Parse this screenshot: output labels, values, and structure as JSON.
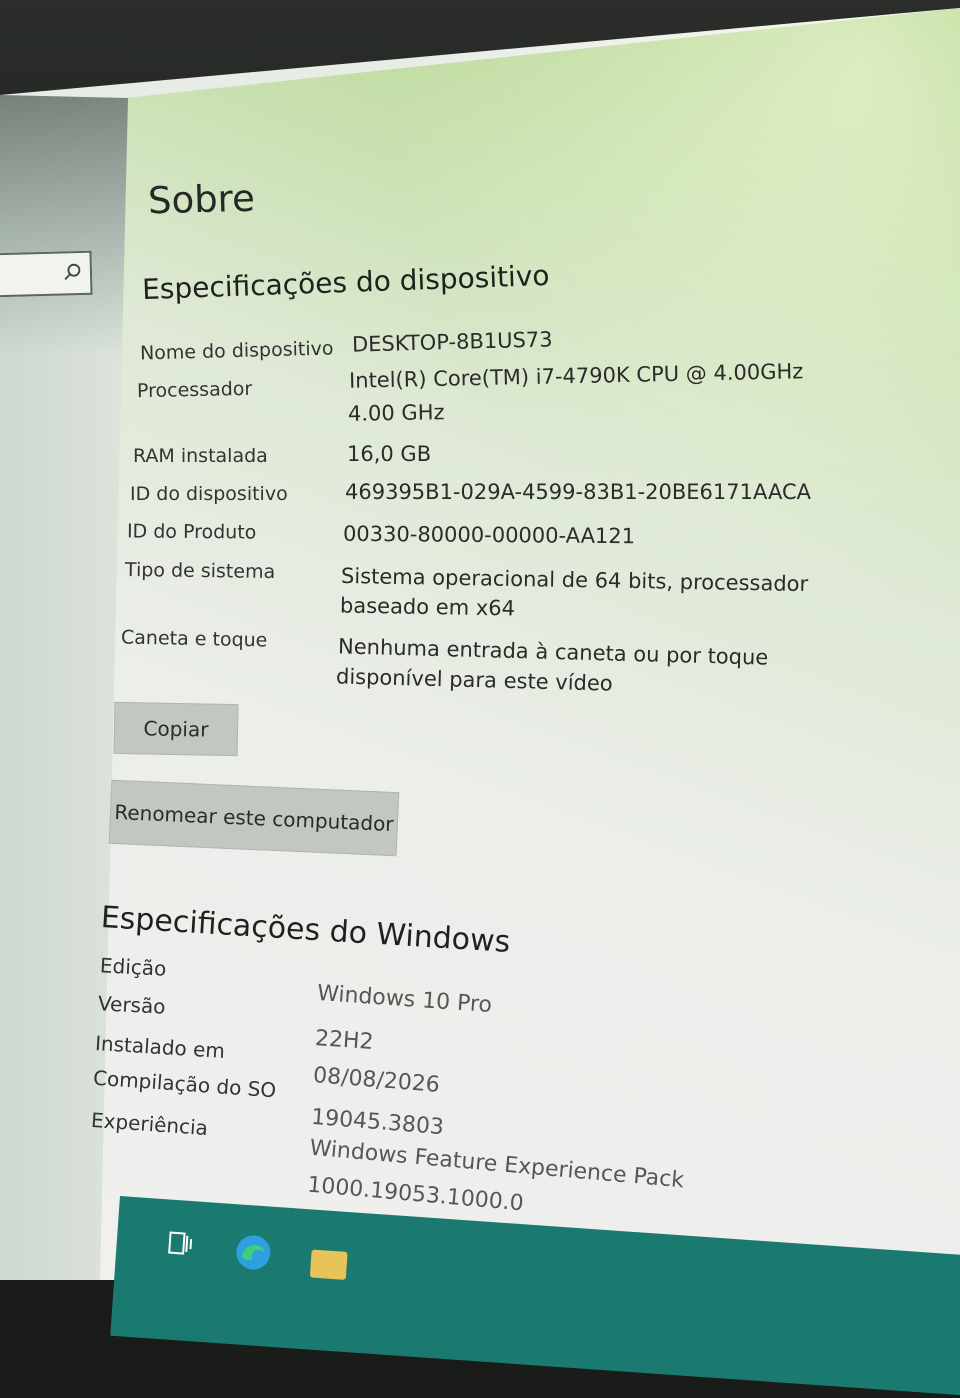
{
  "page": {
    "title": "Sobre"
  },
  "device_specs": {
    "heading": "Especificações do dispositivo",
    "rows": [
      {
        "label": "Nome do dispositivo",
        "value": "DESKTOP-8B1US73",
        "value2": ""
      },
      {
        "label": "Processador",
        "value": "Intel(R) Core(TM) i7-4790K CPU @ 4.00GHz",
        "value2": "4.00 GHz"
      },
      {
        "label": "RAM instalada",
        "value": "16,0 GB",
        "value2": ""
      },
      {
        "label": "ID do dispositivo",
        "value": "469395B1-029A-4599-83B1-20BE6171AACA",
        "value2": ""
      },
      {
        "label": "ID do Produto",
        "value": "00330-80000-00000-AA121",
        "value2": ""
      },
      {
        "label": "Tipo de sistema",
        "value": "Sistema operacional de 64 bits, processador",
        "value2": "baseado em x64"
      },
      {
        "label": "Caneta e toque",
        "value": "Nenhuma entrada à caneta ou por toque",
        "value2": "disponível para este vídeo"
      }
    ],
    "copy_button": "Copiar",
    "rename_button": "Renomear este computador"
  },
  "windows_specs": {
    "heading": "Especificações do Windows",
    "rows": [
      {
        "label": "Edição",
        "value": "Windows 10 Pro",
        "value2": ""
      },
      {
        "label": "Versão",
        "value": "22H2",
        "value2": ""
      },
      {
        "label": "Instalado em",
        "value": "08/08/2026",
        "value2": ""
      },
      {
        "label": "Compilação do SO",
        "value": "19045.3803",
        "value2": ""
      },
      {
        "label": "Experiência",
        "value": "Windows Feature Experience Pack",
        "value2": "1000.19053.1000.0"
      }
    ]
  },
  "taskbar": {
    "icons": [
      "task-view-icon",
      "edge-icon",
      "file-explorer-icon"
    ],
    "color": "#1a7a70"
  }
}
